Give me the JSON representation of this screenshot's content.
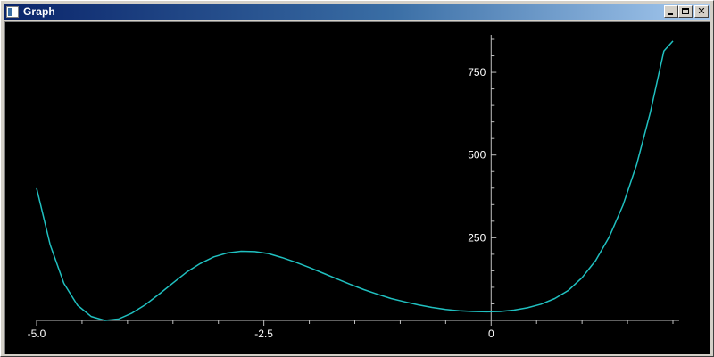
{
  "window": {
    "title": "Graph",
    "icon": "graph-window-icon",
    "controls": {
      "minimize_icon": "minimize-icon",
      "maximize_icon": "maximize-icon",
      "close_icon": "close-icon",
      "close_glyph": "✕"
    }
  },
  "colors": {
    "background": "#000000",
    "axis": "#c0c0c0",
    "tick_label": "#ffffff",
    "curve": "#20c0c0"
  },
  "chart_data": {
    "type": "line",
    "title": "",
    "xlabel": "",
    "ylabel": "",
    "xlim": [
      -5.0,
      2.0
    ],
    "ylim": [
      0,
      850
    ],
    "grid": false,
    "x_ticks": [
      {
        "value": -5.0,
        "label": "-5.0"
      },
      {
        "value": -2.5,
        "label": "-2.5"
      },
      {
        "value": 0,
        "label": "0"
      }
    ],
    "y_ticks": [
      {
        "value": 250,
        "label": "250"
      },
      {
        "value": 500,
        "label": "500"
      },
      {
        "value": 750,
        "label": "750"
      }
    ],
    "series": [
      {
        "color": "#20c0c0",
        "x": [
          -5.0,
          -4.85,
          -4.7,
          -4.55,
          -4.4,
          -4.25,
          -4.1,
          -3.95,
          -3.8,
          -3.65,
          -3.5,
          -3.35,
          -3.2,
          -3.05,
          -2.9,
          -2.75,
          -2.6,
          -2.45,
          -2.3,
          -2.15,
          -2.0,
          -1.85,
          -1.7,
          -1.55,
          -1.4,
          -1.25,
          -1.1,
          -0.95,
          -0.8,
          -0.65,
          -0.5,
          -0.35,
          -0.2,
          -0.05,
          0.1,
          0.25,
          0.4,
          0.55,
          0.7,
          0.85,
          1.0,
          1.15,
          1.3,
          1.45,
          1.6,
          1.75,
          1.9,
          2.0
        ],
        "y": [
          400,
          228,
          112,
          46,
          12,
          0,
          4,
          22,
          48,
          80,
          113,
          146,
          172,
          192,
          204,
          209,
          208,
          202,
          190,
          176,
          160,
          143,
          126,
          109,
          93,
          79,
          66,
          56,
          47,
          39,
          33,
          29,
          27,
          26,
          27,
          31,
          38,
          49,
          66,
          91,
          129,
          181,
          253,
          348,
          471,
          627,
          814,
          845
        ]
      }
    ]
  }
}
